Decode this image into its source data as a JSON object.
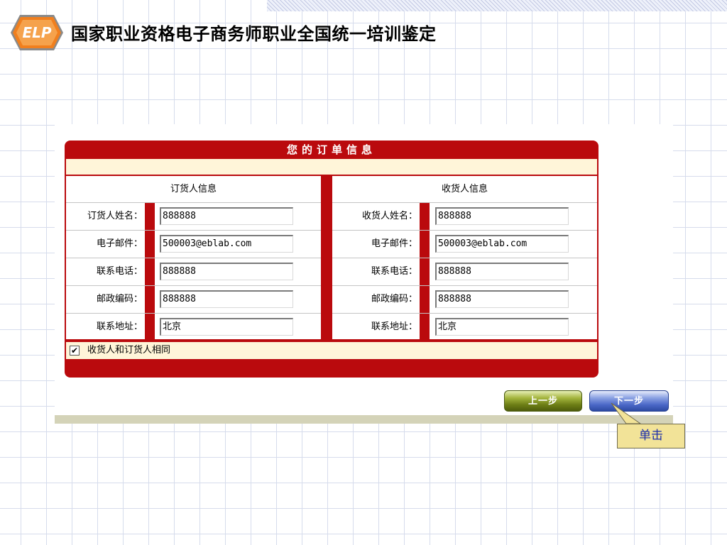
{
  "header": {
    "logo_text": "ELP",
    "title": "国家职业资格电子商务师职业全国统一培训鉴定"
  },
  "order_panel": {
    "title": "您的订单信息",
    "orderer": {
      "header": "订货人信息",
      "fields": [
        {
          "label": "订货人姓名：",
          "value": "888888"
        },
        {
          "label": "电子邮件：",
          "value": "500003@eblab.com"
        },
        {
          "label": "联系电话：",
          "value": "888888"
        },
        {
          "label": "邮政编码：",
          "value": "888888"
        },
        {
          "label": "联系地址：",
          "value": "北京"
        }
      ]
    },
    "receiver": {
      "header": "收货人信息",
      "fields": [
        {
          "label": "收货人姓名：",
          "value": "888888"
        },
        {
          "label": "电子邮件：",
          "value": "500003@eblab.com"
        },
        {
          "label": "联系电话：",
          "value": "888888"
        },
        {
          "label": "邮政编码：",
          "value": "888888"
        },
        {
          "label": "联系地址：",
          "value": "北京"
        }
      ]
    },
    "same_as_orderer": {
      "checked": true,
      "check_mark": "✔",
      "label": "收货人和订货人相同"
    }
  },
  "navigation": {
    "prev_label": "上一步",
    "next_label": "下一步"
  },
  "annotation": {
    "callout_text": "单击"
  },
  "colors": {
    "panel_red": "#ba0a0d",
    "cream": "#fff5d9",
    "callout_fill": "#f2e398",
    "callout_text": "#1a2caa"
  }
}
